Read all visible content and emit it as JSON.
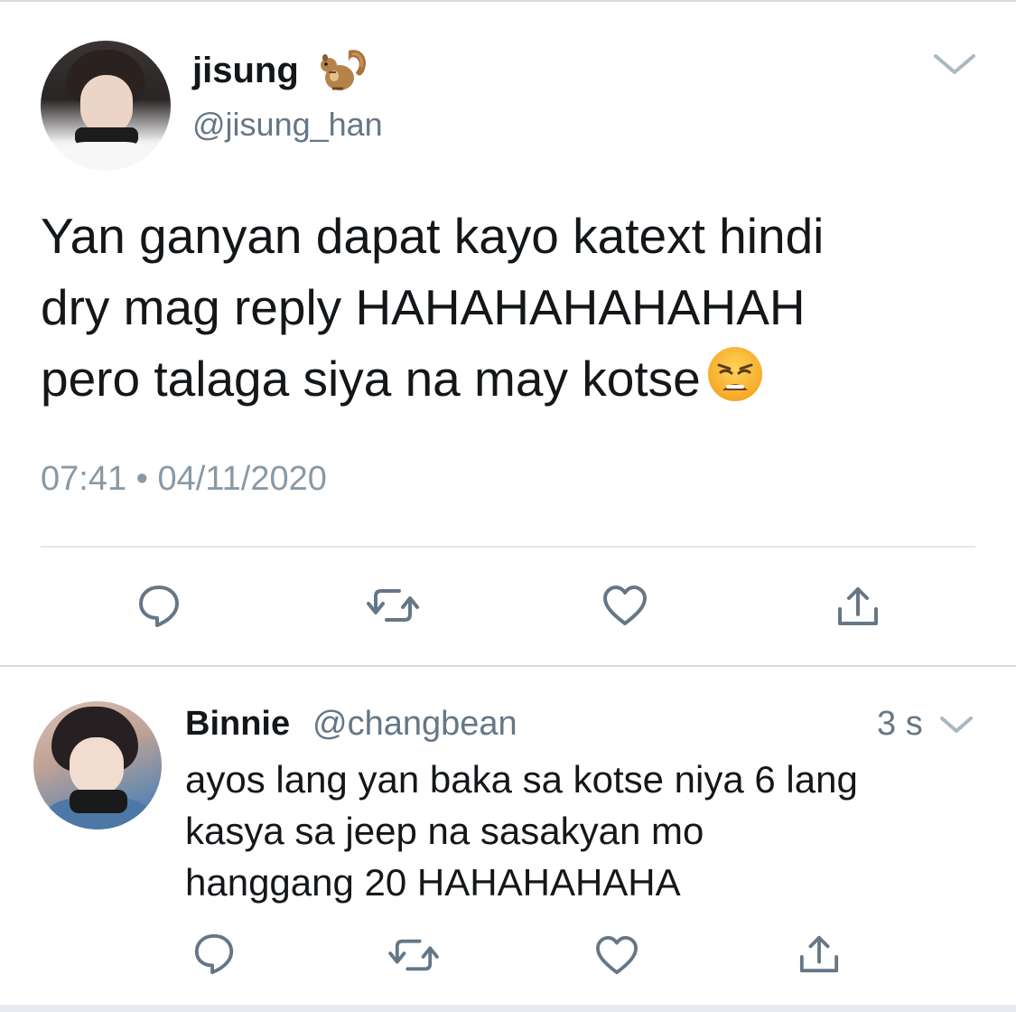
{
  "tweet": {
    "display_name": "jisung",
    "name_emoji": "squirrel",
    "handle": "@jisung_han",
    "text": "Yan ganyan dapat kayo katext hindi\ndry mag reply HAHAHAHAHAHAH\npero talaga siya na may kotse",
    "text_emoji": "weary-face",
    "timestamp": "07:41 • 04/11/2020"
  },
  "reply": {
    "display_name": "Binnie",
    "handle": "@changbean",
    "time": "3 s",
    "text": "ayos lang yan baka sa kotse niya 6 lang\nkasya sa jeep na sasakyan mo\nhanggang 20 HAHAHAHAHA"
  },
  "icons": {
    "reply": "reply-icon",
    "retweet": "retweet-icon",
    "like": "heart-icon",
    "share": "share-icon",
    "menu": "chevron-down-icon"
  },
  "colors": {
    "text": "#14171a",
    "secondary": "#657786",
    "icon": "#657786",
    "divider": "#e1e8ed"
  }
}
